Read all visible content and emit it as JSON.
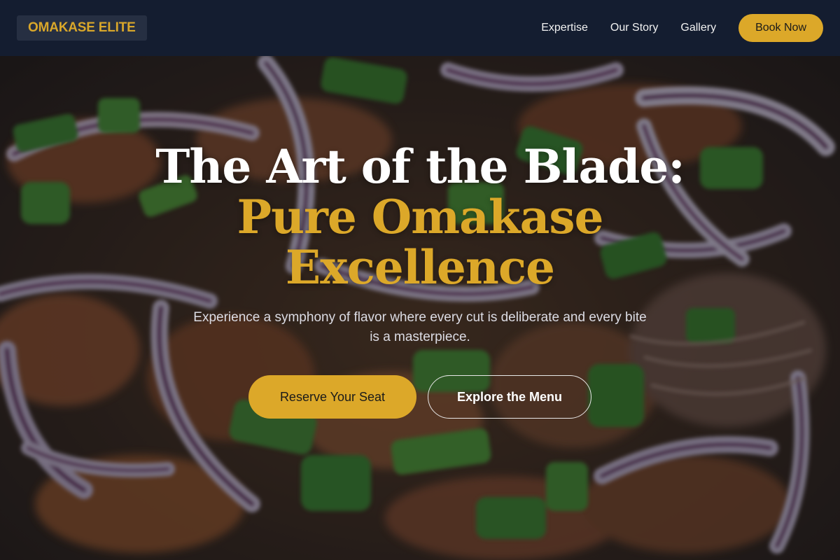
{
  "nav": {
    "logo": "OMAKASE ELITE",
    "links": [
      "Expertise",
      "Our Story",
      "Gallery"
    ],
    "book_label": "Book Now"
  },
  "hero": {
    "title_line1": "The Art of the Blade:",
    "title_line2": "Pure Omakase Excellence",
    "subtitle": "Experience a symphony of flavor where every cut is deliberate and every bite is a masterpiece.",
    "primary_cta": "Reserve Your Seat",
    "secondary_cta": "Explore the Menu"
  },
  "colors": {
    "nav_bg": "#141d30",
    "accent_gold": "#dca829",
    "logo_bg": "#262f42"
  }
}
